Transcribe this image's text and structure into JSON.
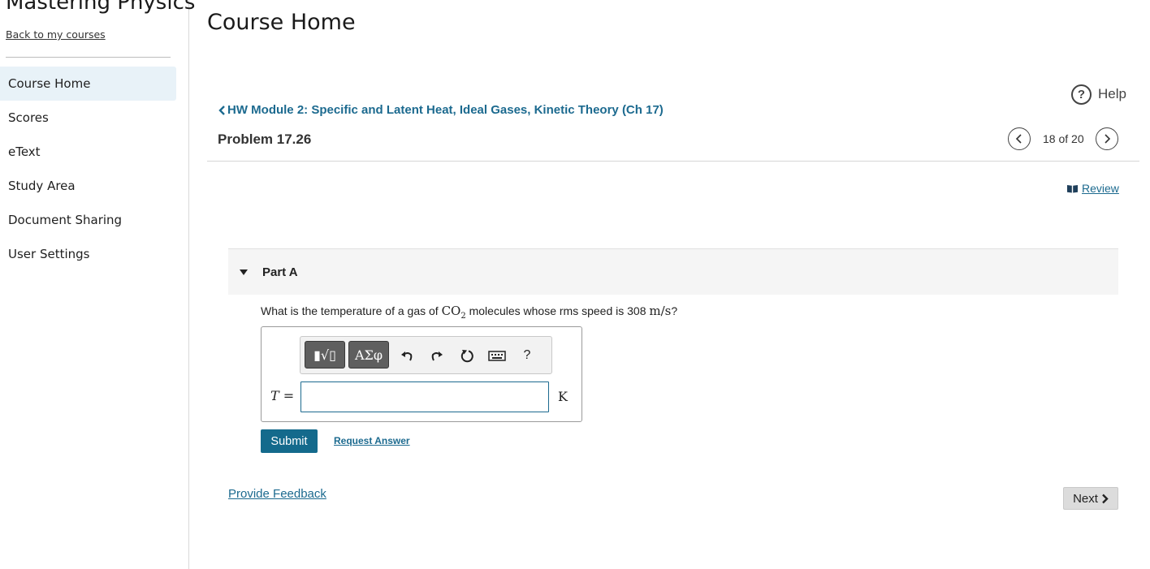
{
  "sidebar": {
    "app_title": "Mastering Physics",
    "back_link": "Back to my courses",
    "items": [
      {
        "label": "Course Home",
        "active": true
      },
      {
        "label": "Scores"
      },
      {
        "label": "eText"
      },
      {
        "label": "Study Area"
      },
      {
        "label": "Document Sharing"
      },
      {
        "label": "User Settings"
      }
    ]
  },
  "header": {
    "page_title": "Course Home",
    "help_label": "Help"
  },
  "assignment": {
    "breadcrumb": "HW Module 2: Specific and Latent Heat, Ideal Gases, Kinetic Theory (Ch 17)",
    "problem_title": "Problem 17.26",
    "pager_text": "18 of 20",
    "review_label": "Review"
  },
  "part": {
    "label": "Part A",
    "question_prefix": "What is the temperature of a gas of ",
    "formula_main": "CO",
    "formula_sub": "2",
    "question_middle": " molecules whose rms speed is 308 ",
    "speed_unit": "m/s",
    "question_suffix": "?"
  },
  "answer": {
    "variable": "T",
    "equals": "=",
    "unit": "K",
    "value": "",
    "toolbar": {
      "templates_glyph": "▮√▯",
      "symbols_glyph": "ΑΣφ",
      "help_glyph": "?"
    }
  },
  "actions": {
    "submit_label": "Submit",
    "request_answer_label": "Request Answer",
    "feedback_label": "Provide Feedback",
    "next_label": "Next"
  },
  "colors": {
    "accent": "#146a8c",
    "link": "#1c6a8f",
    "active_nav_bg": "#e8f2f8"
  }
}
